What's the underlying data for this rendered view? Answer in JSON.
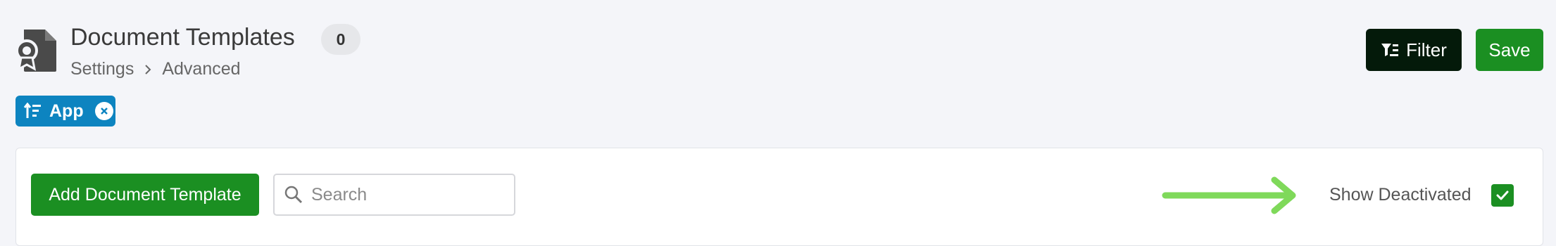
{
  "header": {
    "title": "Document Templates",
    "count": "0",
    "icon": "document-certificate-icon",
    "breadcrumb": [
      "Settings",
      "Advanced"
    ]
  },
  "toolbar": {
    "filter_label": "Filter",
    "save_label": "Save"
  },
  "active_filters": [
    {
      "label": "App",
      "icon": "sort-ascending-icon"
    }
  ],
  "content": {
    "add_button_label": "Add Document Template",
    "search": {
      "placeholder": "Search",
      "value": ""
    },
    "show_deactivated": {
      "label": "Show Deactivated",
      "checked": true
    }
  },
  "colors": {
    "primary_green": "#1b8f22",
    "filter_dark": "#041a0a",
    "chip_blue": "#0d84c0",
    "annotation_arrow": "#7fd95a",
    "background": "#f4f5f9"
  }
}
